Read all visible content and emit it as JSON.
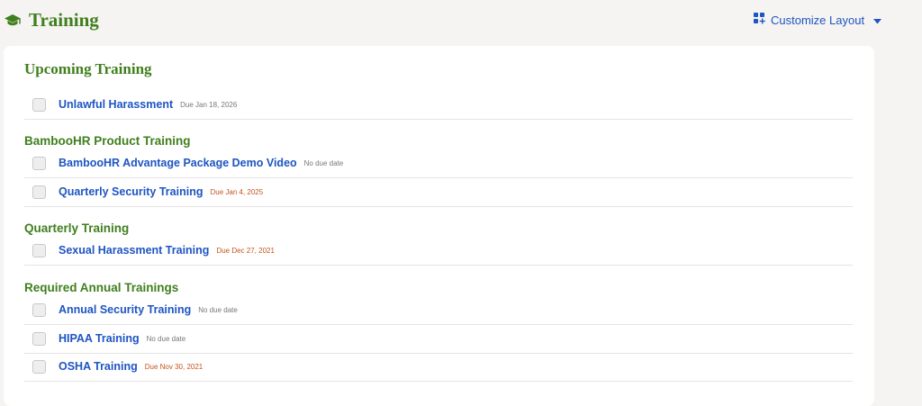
{
  "header": {
    "title": "Training",
    "title_icon": "graduation-cap-icon",
    "customize_label": "Customize Layout",
    "customize_icon": "layout-grid-icon"
  },
  "colors": {
    "accent_green": "#3f7f1d",
    "link_blue": "#1e55c2",
    "overdue_orange": "#c4541b"
  },
  "card": {
    "title": "Upcoming Training",
    "items": [
      {
        "name": "Unlawful Harassment",
        "due": "Due Jan 18, 2026",
        "overdue": false
      }
    ],
    "groups": [
      {
        "title": "BambooHR Product Training",
        "items": [
          {
            "name": "BambooHR Advantage Package Demo Video",
            "due": "No due date",
            "overdue": false
          },
          {
            "name": "Quarterly Security Training",
            "due": "Due Jan 4, 2025",
            "overdue": true
          }
        ]
      },
      {
        "title": "Quarterly Training",
        "items": [
          {
            "name": "Sexual Harassment Training",
            "due": "Due Dec 27, 2021",
            "overdue": true
          }
        ]
      },
      {
        "title": "Required Annual Trainings",
        "items": [
          {
            "name": "Annual Security Training",
            "due": "No due date",
            "overdue": false
          },
          {
            "name": "HIPAA Training",
            "due": "No due date",
            "overdue": false
          },
          {
            "name": "OSHA Training",
            "due": "Due Nov 30, 2021",
            "overdue": true
          }
        ]
      }
    ]
  }
}
